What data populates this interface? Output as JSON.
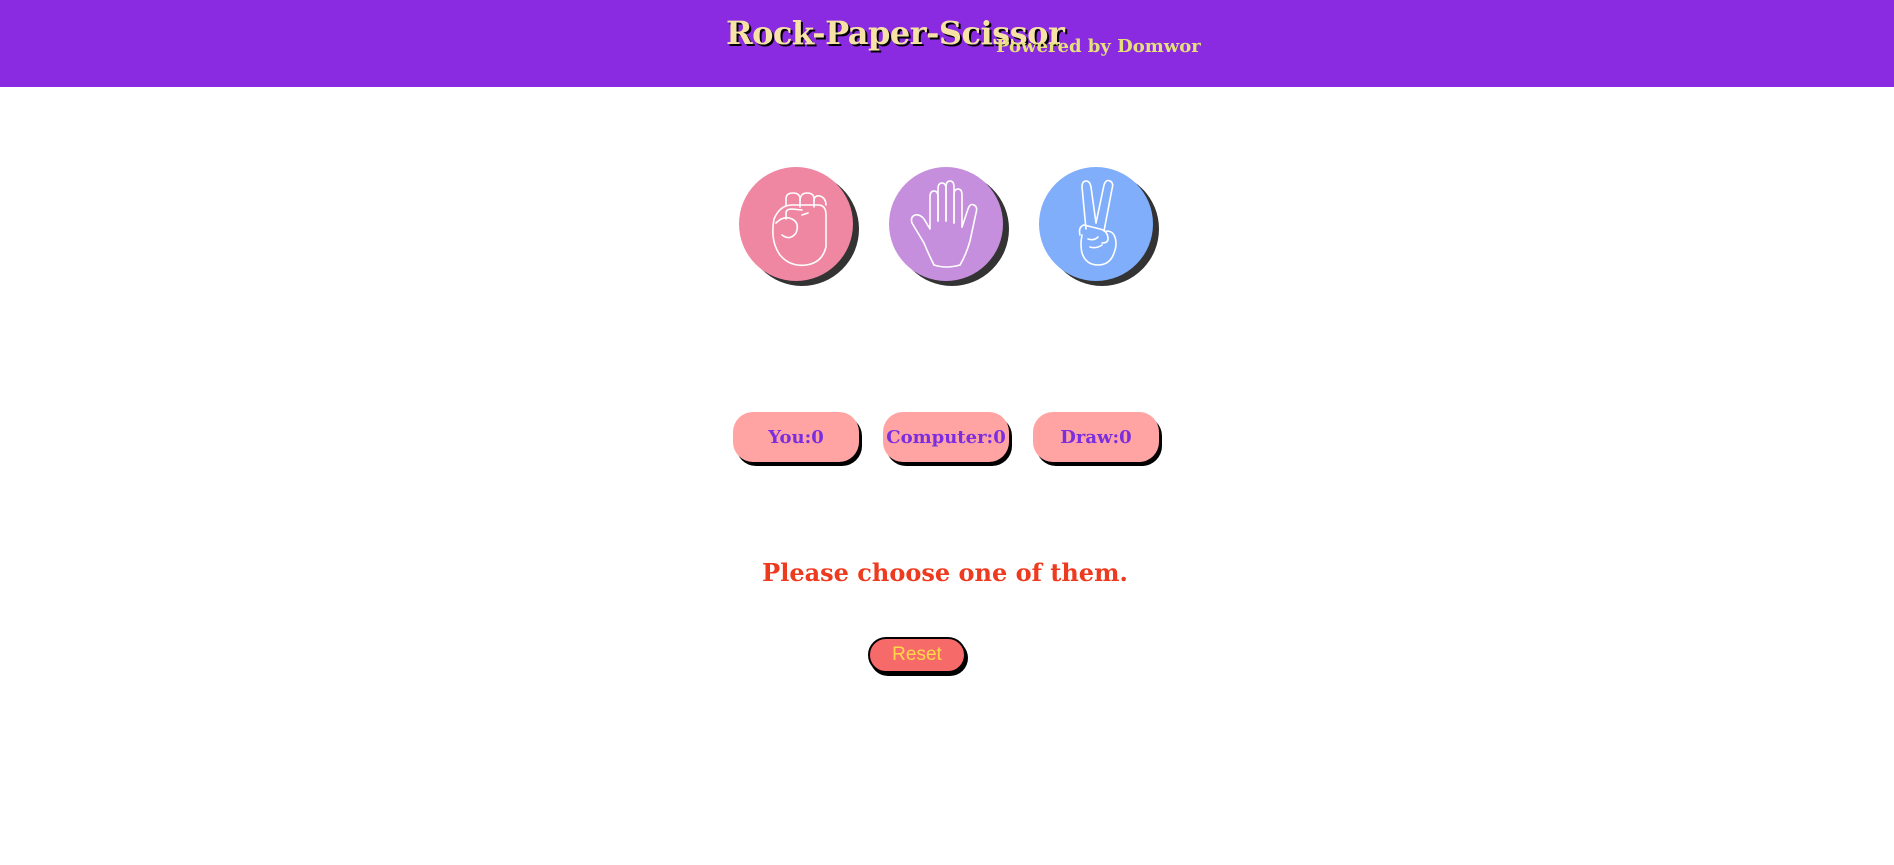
{
  "header": {
    "title": "Rock-Paper-Scissor",
    "subtitle": "Powered by Domwor",
    "background": "#8a2be2"
  },
  "choices": [
    {
      "name": "rock",
      "icon": "fist-icon",
      "color": "#ef87a2"
    },
    {
      "name": "paper",
      "icon": "open-hand-icon",
      "color": "#c68fdd"
    },
    {
      "name": "scissor",
      "icon": "peace-hand-icon",
      "color": "#80aefb"
    }
  ],
  "scores": {
    "you": "You:0",
    "computer": "Computer:0",
    "draw": "Draw:0"
  },
  "message": "Please choose one of them.",
  "reset_label": "Reset"
}
